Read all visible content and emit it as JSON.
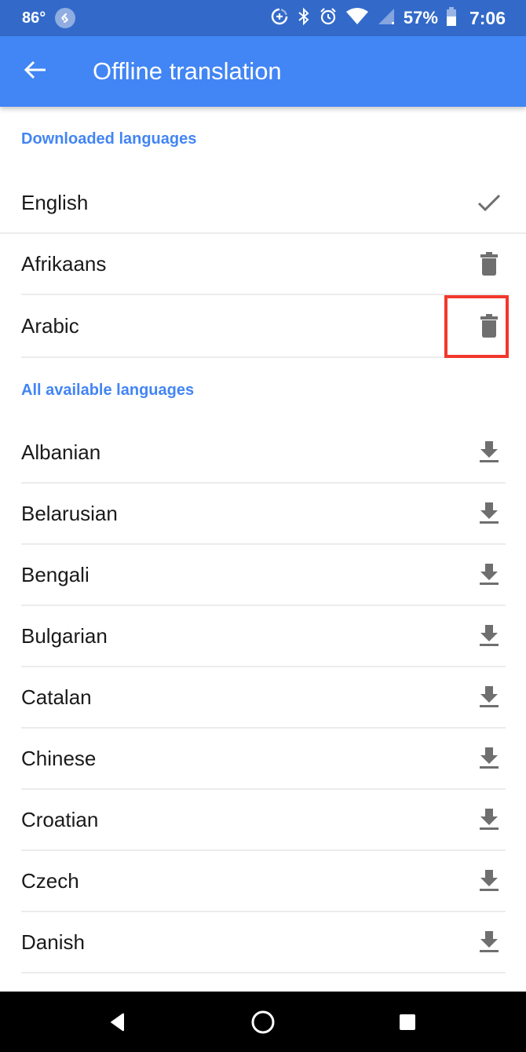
{
  "status_bar": {
    "temperature": "86°",
    "battery_percent": "57%",
    "time": "7:06",
    "icons": [
      "shazam-icon",
      "data-saver-icon",
      "bluetooth-icon",
      "alarm-icon",
      "wifi-icon",
      "cell-signal-icon",
      "battery-icon"
    ]
  },
  "app_bar": {
    "back_icon": "arrow-left-icon",
    "title": "Offline translation"
  },
  "downloaded_section": {
    "header": "Downloaded languages",
    "items": [
      {
        "name": "English",
        "action_icon": "check-icon"
      },
      {
        "name": "Afrikaans",
        "action_icon": "trash-icon"
      },
      {
        "name": "Arabic",
        "action_icon": "trash-icon",
        "highlighted": true
      }
    ]
  },
  "available_section": {
    "header": "All available languages",
    "items": [
      {
        "name": "Albanian",
        "action_icon": "download-icon"
      },
      {
        "name": "Belarusian",
        "action_icon": "download-icon"
      },
      {
        "name": "Bengali",
        "action_icon": "download-icon"
      },
      {
        "name": "Bulgarian",
        "action_icon": "download-icon"
      },
      {
        "name": "Catalan",
        "action_icon": "download-icon"
      },
      {
        "name": "Chinese",
        "action_icon": "download-icon"
      },
      {
        "name": "Croatian",
        "action_icon": "download-icon"
      },
      {
        "name": "Czech",
        "action_icon": "download-icon"
      },
      {
        "name": "Danish",
        "action_icon": "download-icon"
      }
    ]
  },
  "colors": {
    "status_bar": "#336ac9",
    "app_bar": "#4285f4",
    "section_header": "#4285f4",
    "icon_gray": "#6f6f6f",
    "highlight": "#f2372c"
  },
  "nav_bar": {
    "icons": [
      "back-triangle-icon",
      "home-circle-icon",
      "recents-square-icon"
    ]
  }
}
